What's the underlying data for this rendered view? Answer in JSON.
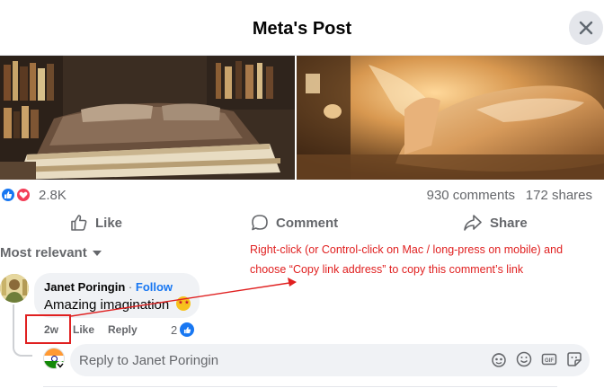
{
  "dialog": {
    "title": "Meta's Post",
    "close_icon": "close-icon"
  },
  "post": {
    "reactions": {
      "icons": [
        "like-icon",
        "love-icon"
      ],
      "count": "2.8K"
    },
    "comments_count": "930 comments",
    "shares_count": "172 shares",
    "actions": {
      "like": "Like",
      "comment": "Comment",
      "share": "Share"
    }
  },
  "comments_section": {
    "sort_label": "Most relevant"
  },
  "annotation": {
    "text": "Right-click (or Control-click on Mac / long-press on mobile) and choose “Copy link address” to copy this comment’s link",
    "color": "#e02020"
  },
  "comment": {
    "author": "Janet Poringin",
    "separator": "·",
    "follow_label": "Follow",
    "text": "Amazing imagination",
    "time": "2w",
    "like_label": "Like",
    "reply_label": "Reply",
    "like_count": "2"
  },
  "reply_box": {
    "placeholder": "Reply to Janet Poringin",
    "icons": [
      "avatar-sticker-icon",
      "emoji-icon",
      "gif-icon",
      "sticker-icon"
    ]
  },
  "colors": {
    "accent": "#1877f2",
    "love": "#f33e58",
    "muted": "#65676b",
    "bubble": "#f0f2f5"
  }
}
